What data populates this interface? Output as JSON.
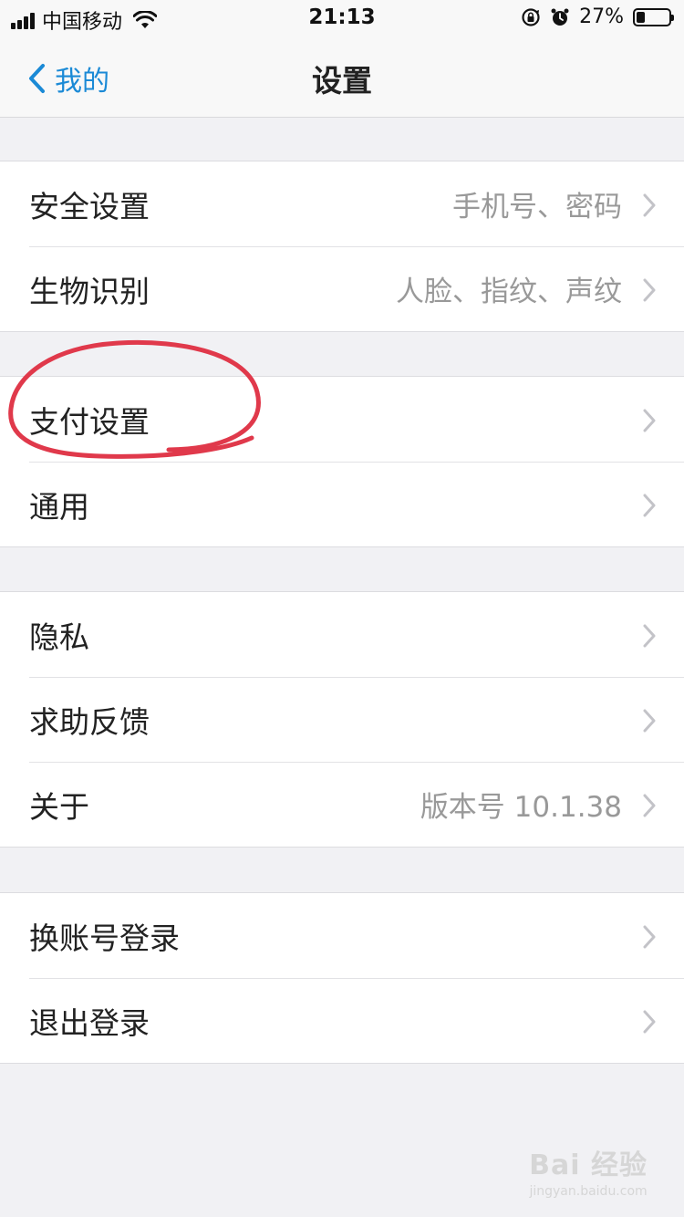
{
  "status_bar": {
    "carrier": "中国移动",
    "time": "21:13",
    "battery_percent": "27%",
    "battery_level": 0.27,
    "icons": [
      "signal-icon",
      "wifi-icon",
      "rotation-lock-icon",
      "alarm-icon",
      "battery-icon"
    ]
  },
  "nav": {
    "back_label": "我的",
    "title": "设置"
  },
  "groups": [
    {
      "rows": [
        {
          "label": "安全设置",
          "value": "手机号、密码"
        },
        {
          "label": "生物识别",
          "value": "人脸、指纹、声纹"
        }
      ]
    },
    {
      "rows": [
        {
          "label": "支付设置",
          "value": ""
        },
        {
          "label": "通用",
          "value": ""
        }
      ]
    },
    {
      "rows": [
        {
          "label": "隐私",
          "value": ""
        },
        {
          "label": "求助反馈",
          "value": ""
        },
        {
          "label": "关于",
          "value": "版本号 10.1.38"
        }
      ]
    },
    {
      "rows": [
        {
          "label": "换账号登录",
          "value": ""
        },
        {
          "label": "退出登录",
          "value": ""
        }
      ]
    }
  ],
  "watermark": {
    "main": "Bai 经验",
    "sub": "jingyan.baidu.com"
  },
  "colors": {
    "accent": "#1b8ad6",
    "annotation": "#e0394b",
    "background": "#f1f1f4"
  }
}
